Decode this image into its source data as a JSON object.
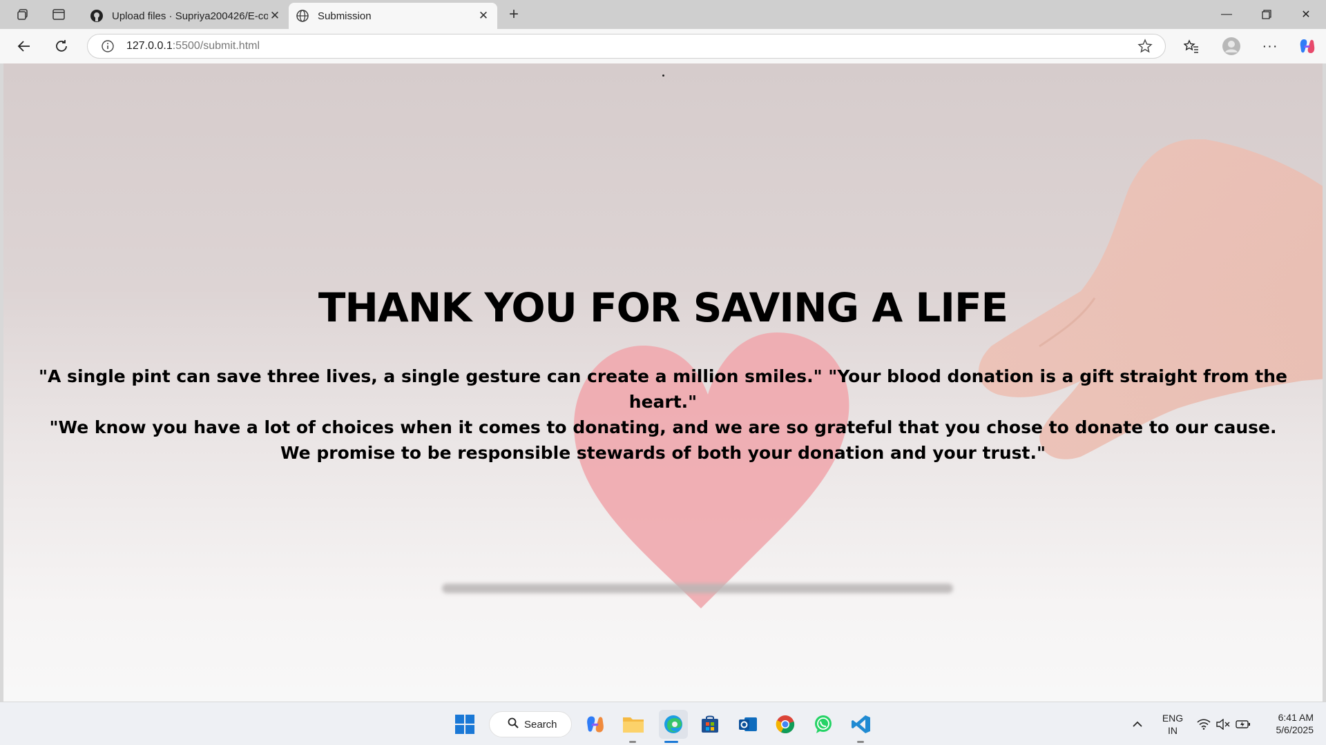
{
  "browser": {
    "tabs": [
      {
        "title": "Upload files · Supriya200426/E-co",
        "icon": "github-icon"
      },
      {
        "title": "Submission",
        "icon": "globe-icon"
      }
    ],
    "url_host": "127.0.0.1",
    "url_path": ":5500/submit.html"
  },
  "page": {
    "title": "THANK YOU FOR SAVING A LIFE",
    "quote_line1": "\"A single pint can save three lives, a single gesture can create a million smiles.\" \"Your blood donation is a gift straight from the heart.\"",
    "quote_line2": "\"We know you have a lot of choices when it comes to donating, and we are so grateful that you chose to donate to our cause. We promise to be responsible stewards of both your donation and your trust.\""
  },
  "taskbar": {
    "search_label": "Search",
    "language": "ENG",
    "region": "IN",
    "time": "6:41 AM",
    "date": "5/6/2025"
  },
  "colors": {
    "heart": "#f0a8ae",
    "hand": "#f1c6bb",
    "background": "#d6cccc"
  }
}
